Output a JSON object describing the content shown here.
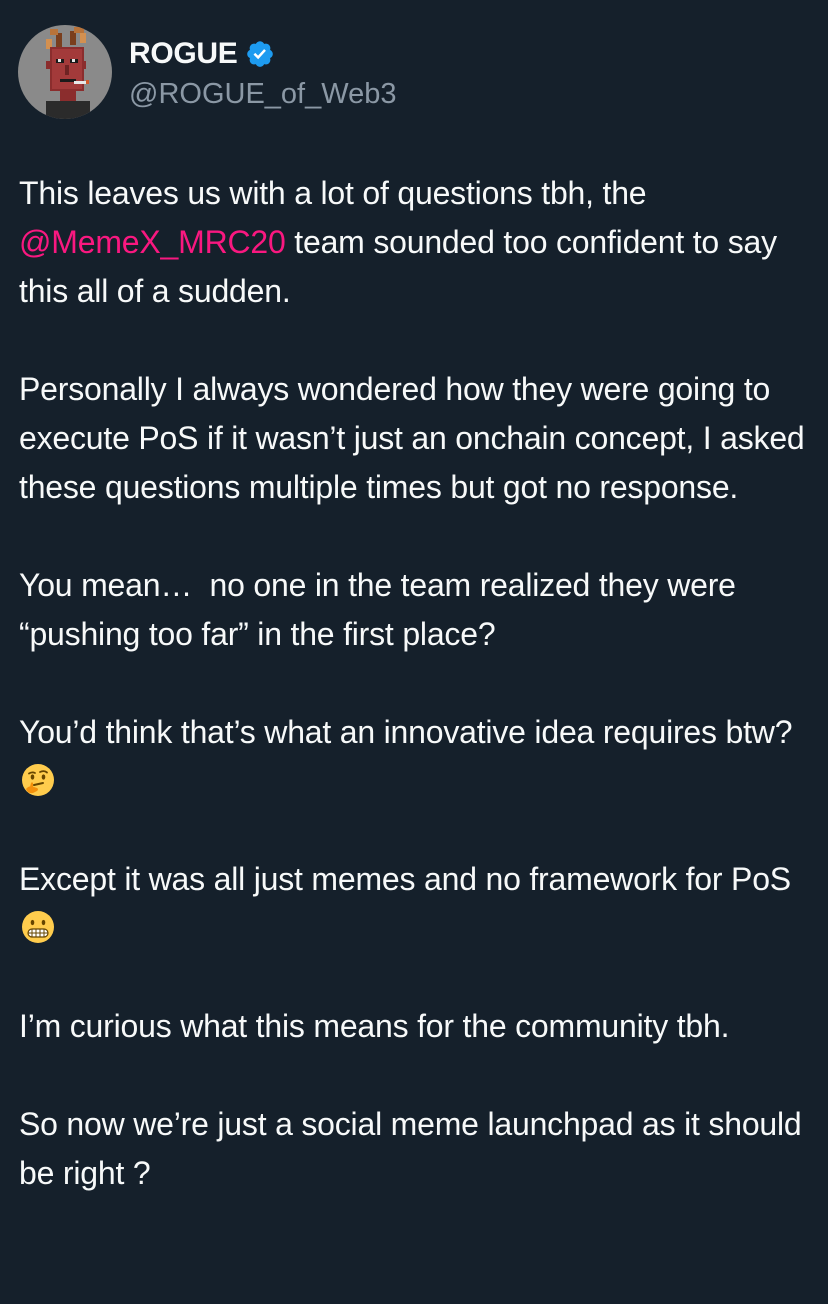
{
  "author": {
    "display_name": "ROGUE",
    "handle": "@ROGUE_of_Web3",
    "verified_icon": "verified-badge-icon",
    "avatar_icon": "pixel-art-avatar"
  },
  "tweet": {
    "p1": {
      "before": "This leaves us with a lot of questions tbh, the ",
      "mention": "@MemeX_MRC20",
      "after": " team sounded too confident to say this all of a sudden."
    },
    "p2": "Personally I always wondered how they were going to execute PoS if it wasn’t just an onchain concept, I asked these questions multiple times but got no response.",
    "p3": "You mean…  no one in the team realized they were “pushing too far” in the first place?",
    "p4": {
      "text": "You’d think that’s what an innovative idea requires btw?",
      "emoji": "thinking-face-emoji"
    },
    "p5": {
      "text": "Except it was all just memes and no framework for PoS",
      "emoji": "grimacing-face-emoji"
    },
    "p6": "I’m curious what this means for the community tbh.",
    "p7": "So now we’re just a social meme launchpad as it should be right ?"
  },
  "colors": {
    "background": "#15202b",
    "text": "#f7f9f9",
    "secondary_text": "#8b98a5",
    "mention": "#f91880",
    "verified": "#1d9bf0"
  }
}
